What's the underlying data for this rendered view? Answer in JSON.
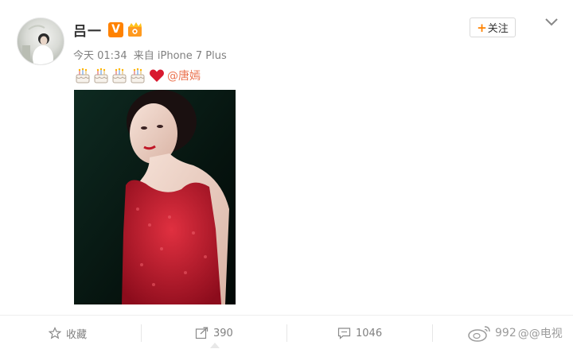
{
  "post": {
    "author": "吕一",
    "verified_badge": "V",
    "member_icon": "member-badge-icon",
    "follow_label": "关注",
    "follow_plus": "+",
    "time": "今天 01:34",
    "source": "来自 iPhone 7 Plus",
    "content": {
      "emojis": [
        "cake-emoji",
        "cake-emoji",
        "cake-emoji",
        "cake-emoji",
        "heart-emoji"
      ],
      "mention": "@唐嫣"
    }
  },
  "actions": {
    "favorite_label": "收藏",
    "repost_count": "390",
    "comment_count": "1046",
    "like_count": "992"
  },
  "watermark": {
    "text": "@@电视"
  },
  "colors": {
    "accent": "#ff8200",
    "mention": "#eb7350",
    "dress": "#c01828"
  }
}
